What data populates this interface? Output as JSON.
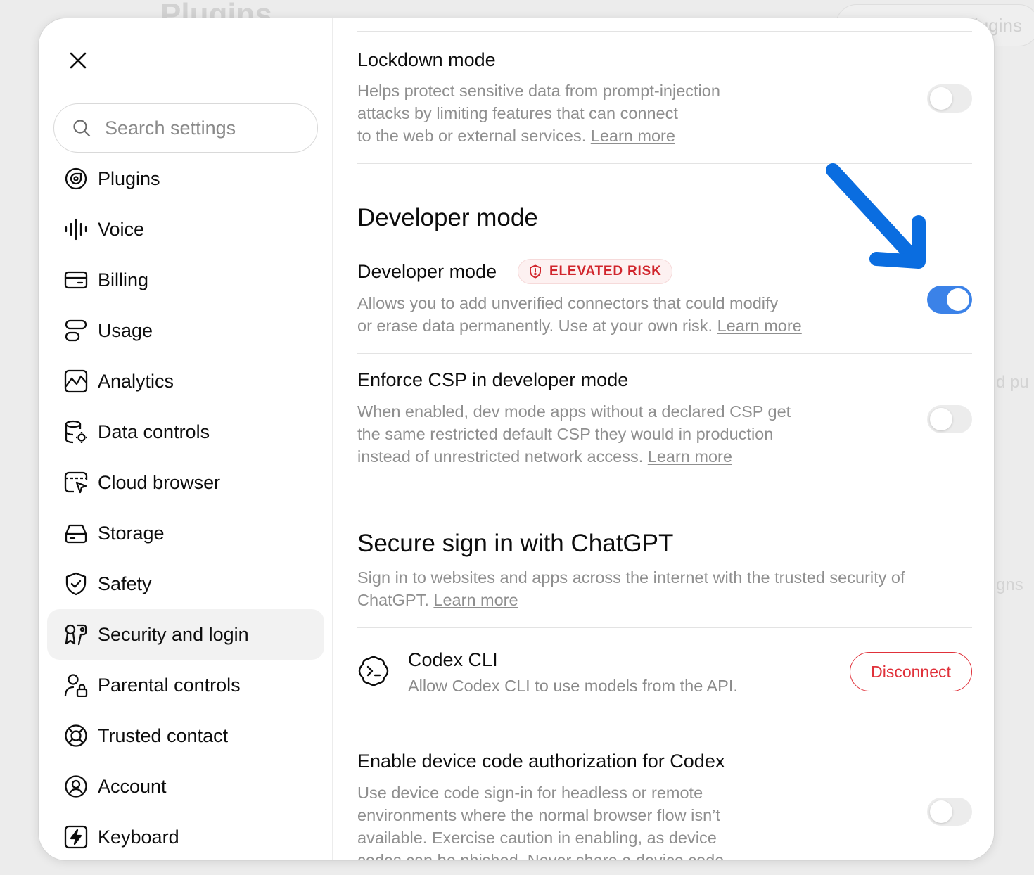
{
  "background": {
    "title": "Plugins",
    "search_placeholder": "Search plugins",
    "frag_1": "d pu",
    "frag_2": "gns"
  },
  "sidebar": {
    "search_placeholder": "Search settings",
    "items": [
      {
        "label": "Plugins",
        "icon": "plugins-icon"
      },
      {
        "label": "Voice",
        "icon": "voice-icon"
      },
      {
        "label": "Billing",
        "icon": "billing-icon"
      },
      {
        "label": "Usage",
        "icon": "usage-icon"
      },
      {
        "label": "Analytics",
        "icon": "analytics-icon"
      },
      {
        "label": "Data controls",
        "icon": "data-controls-icon"
      },
      {
        "label": "Cloud browser",
        "icon": "cloud-browser-icon"
      },
      {
        "label": "Storage",
        "icon": "storage-icon"
      },
      {
        "label": "Safety",
        "icon": "safety-icon"
      },
      {
        "label": "Security and login",
        "icon": "security-login-icon",
        "active": true
      },
      {
        "label": "Parental controls",
        "icon": "parental-controls-icon"
      },
      {
        "label": "Trusted contact",
        "icon": "trusted-contact-icon"
      },
      {
        "label": "Account",
        "icon": "account-icon"
      },
      {
        "label": "Keyboard",
        "icon": "keyboard-icon"
      }
    ]
  },
  "lockdown": {
    "title": "Lockdown mode",
    "desc_1": "Helps protect sensitive data from prompt-injection",
    "desc_2": "attacks by limiting features that can connect",
    "desc_3": "to the web or external services. ",
    "link": "Learn more",
    "enabled": false
  },
  "developer": {
    "section_title": "Developer mode",
    "title": "Developer mode",
    "badge": "ELEVATED RISK",
    "desc_1": "Allows you to add unverified connectors that could modify",
    "desc_2": "or erase data permanently. Use at your own risk. ",
    "link": "Learn more",
    "enabled": true
  },
  "csp": {
    "title": "Enforce CSP in developer mode",
    "desc_1": "When enabled, dev mode apps without a declared CSP get",
    "desc_2": "the same restricted default CSP they would in production",
    "desc_3": "instead of unrestricted network access. ",
    "link": "Learn more",
    "enabled": false
  },
  "secure_signin": {
    "section_title": "Secure sign in with ChatGPT",
    "desc_1": "Sign in to websites and apps across the internet with the trusted security of",
    "desc_2": "ChatGPT. ",
    "link": "Learn more"
  },
  "codex_cli": {
    "title": "Codex CLI",
    "desc": "Allow Codex CLI to use models from the API.",
    "button": "Disconnect"
  },
  "device_code": {
    "title": "Enable device code authorization for Codex",
    "desc_1": "Use device code sign-in for headless or remote",
    "desc_2": "environments where the normal browser flow isn’t",
    "desc_3": "available. Exercise caution in enabling, as device",
    "desc_4": "codes can be phished. Never share a device code",
    "enabled": false
  },
  "colors": {
    "accent": "#3b82e8",
    "danger": "#e0313a",
    "arrow": "#0a6de0"
  }
}
